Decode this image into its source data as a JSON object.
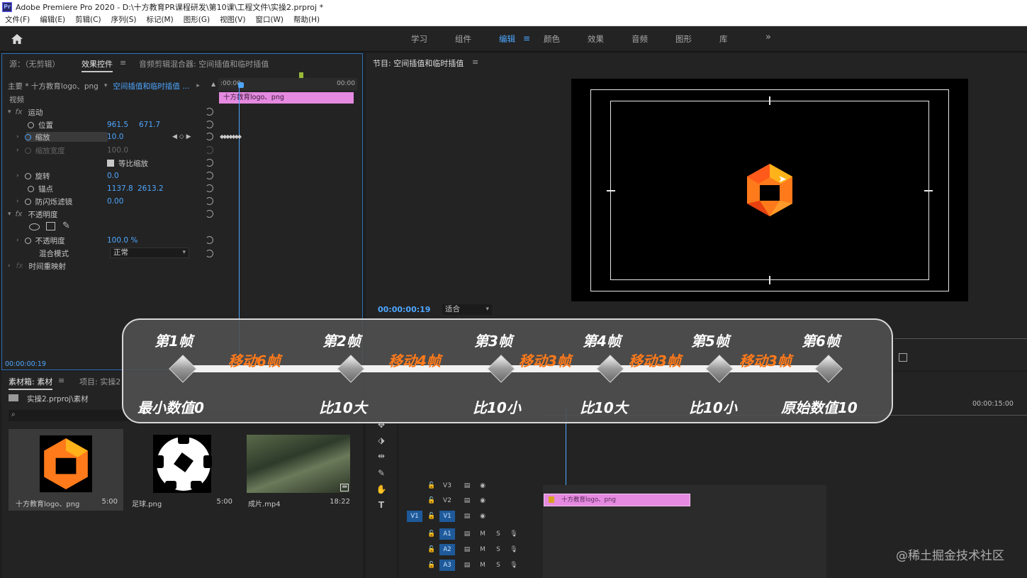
{
  "window": {
    "app_badge": "Pr",
    "title": "Adobe Premiere Pro 2020 - D:\\十方教育PR课程研发\\第10课\\工程文件\\实操2.prproj *"
  },
  "menu": [
    "文件(F)",
    "编辑(E)",
    "剪辑(C)",
    "序列(S)",
    "标记(M)",
    "图形(G)",
    "视图(V)",
    "窗口(W)",
    "帮助(H)"
  ],
  "workspaces": {
    "items": [
      "学习",
      "组件",
      "编辑",
      "颜色",
      "效果",
      "音频",
      "图形",
      "库"
    ],
    "active_index": 2,
    "more": "»"
  },
  "effect_controls": {
    "tabs": [
      "源：（无剪辑）",
      "效果控件",
      "音频剪辑混合器: 空间插值和临时插值"
    ],
    "active_tab": 1,
    "menu_icon": "≡",
    "source_label": "主要 * 十方教育logo、png",
    "sequence_label": "空间插值和临时插值 ...",
    "timecode_start": ":00:00",
    "timecode_end": "00:00",
    "clip_label": "十方教育logo、png",
    "section_video": "视频",
    "motion": "运动",
    "position_label": "位置",
    "position_x": "961.5",
    "position_y": "671.7",
    "scale_label": "缩放",
    "scale_value": "10.0",
    "scale_width_label": "缩放宽度",
    "scale_width_value": "100.0",
    "uniform_scale": "等比缩放",
    "rotation_label": "旋转",
    "rotation_value": "0.0",
    "anchor_label": "锚点",
    "anchor_x": "1137.8",
    "anchor_y": "2613.2",
    "flicker_label": "防闪烁滤镜",
    "flicker_value": "0.00",
    "opacity_section": "不透明度",
    "opacity_label": "不透明度",
    "opacity_value": "100.0 %",
    "blend_label": "混合模式",
    "blend_value": "正常",
    "time_remap": "时间重映射",
    "current_time": "00:00:00:19"
  },
  "program": {
    "title": "节目: 空间插值和临时插值",
    "menu_icon": "≡",
    "timecode": "00:00:00:19",
    "fit": "适合"
  },
  "project": {
    "tabs": [
      "素材箱: 素材",
      "项目: 实操2"
    ],
    "path": "实操2.prproj\\素材",
    "items": [
      {
        "name": "十方教育logo、png",
        "duration": "5:00"
      },
      {
        "name": "足球.png",
        "duration": "5:00"
      },
      {
        "name": "成片.mp4",
        "duration": "18:22"
      }
    ]
  },
  "timeline": {
    "ruler_end": "00:00:15:00",
    "clip_label": "十方教育logo、png",
    "v_tracks": [
      "V3",
      "V2",
      "V1"
    ],
    "a_tracks": [
      "A1",
      "A2",
      "A3"
    ],
    "source_patch": "V1",
    "mute": "M",
    "solo": "S"
  },
  "overlay": {
    "frames": [
      "第1帧",
      "第2帧",
      "第3帧",
      "第4帧",
      "第5帧",
      "第6帧"
    ],
    "moves": [
      "移动6帧",
      "移动4帧",
      "移动3帧",
      "移动3帧",
      "移动3帧"
    ],
    "values": [
      "最小数值0",
      "比10大",
      "比10小",
      "比10大",
      "比10小",
      "原始数值10"
    ]
  },
  "watermark": "@稀土掘金技术社区",
  "colors": {
    "accent": "#4ea6ff",
    "clip": "#e58ae0",
    "highlight": "#ff7a1a"
  }
}
